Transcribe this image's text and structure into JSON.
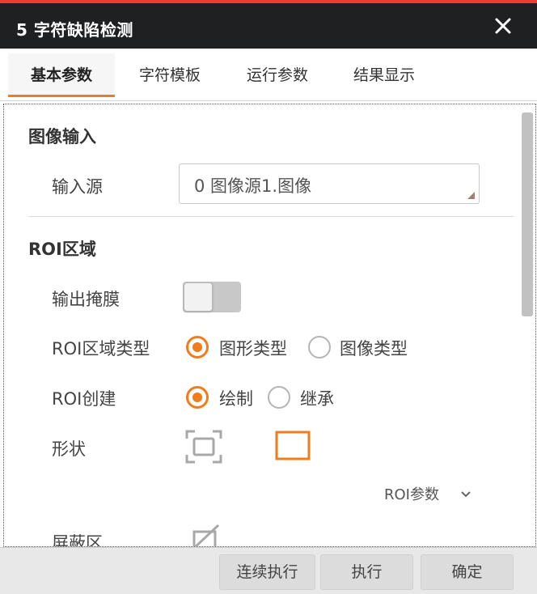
{
  "window": {
    "title": "5 字符缺陷检测"
  },
  "tabs": [
    {
      "label": "基本参数",
      "active": true
    },
    {
      "label": "字符模板",
      "active": false
    },
    {
      "label": "运行参数",
      "active": false
    },
    {
      "label": "结果显示",
      "active": false
    }
  ],
  "image_input": {
    "section_title": "图像输入",
    "source_label": "输入源",
    "source_value": "0 图像源1.图像"
  },
  "roi": {
    "section_title": "ROI区域",
    "output_mask_label": "输出掩膜",
    "output_mask_on": false,
    "region_type_label": "ROI区域类型",
    "region_type_options": [
      "图形类型",
      "图像类型"
    ],
    "region_type_selected": "图形类型",
    "create_label": "ROI创建",
    "create_options": [
      "绘制",
      "继承"
    ],
    "create_selected": "绘制",
    "shape_label": "形状",
    "shape_icons": [
      "fullscreen-frame-icon",
      "rectangle-icon"
    ],
    "param_link": "ROI参数",
    "mask_label": "屏蔽区"
  },
  "footer": {
    "continuous_run": "连续执行",
    "run": "执行",
    "confirm": "确定"
  },
  "colors": {
    "accent": "#f07c1e",
    "titlebar": "#1f2022",
    "top_strip": "#ee3e2e"
  }
}
